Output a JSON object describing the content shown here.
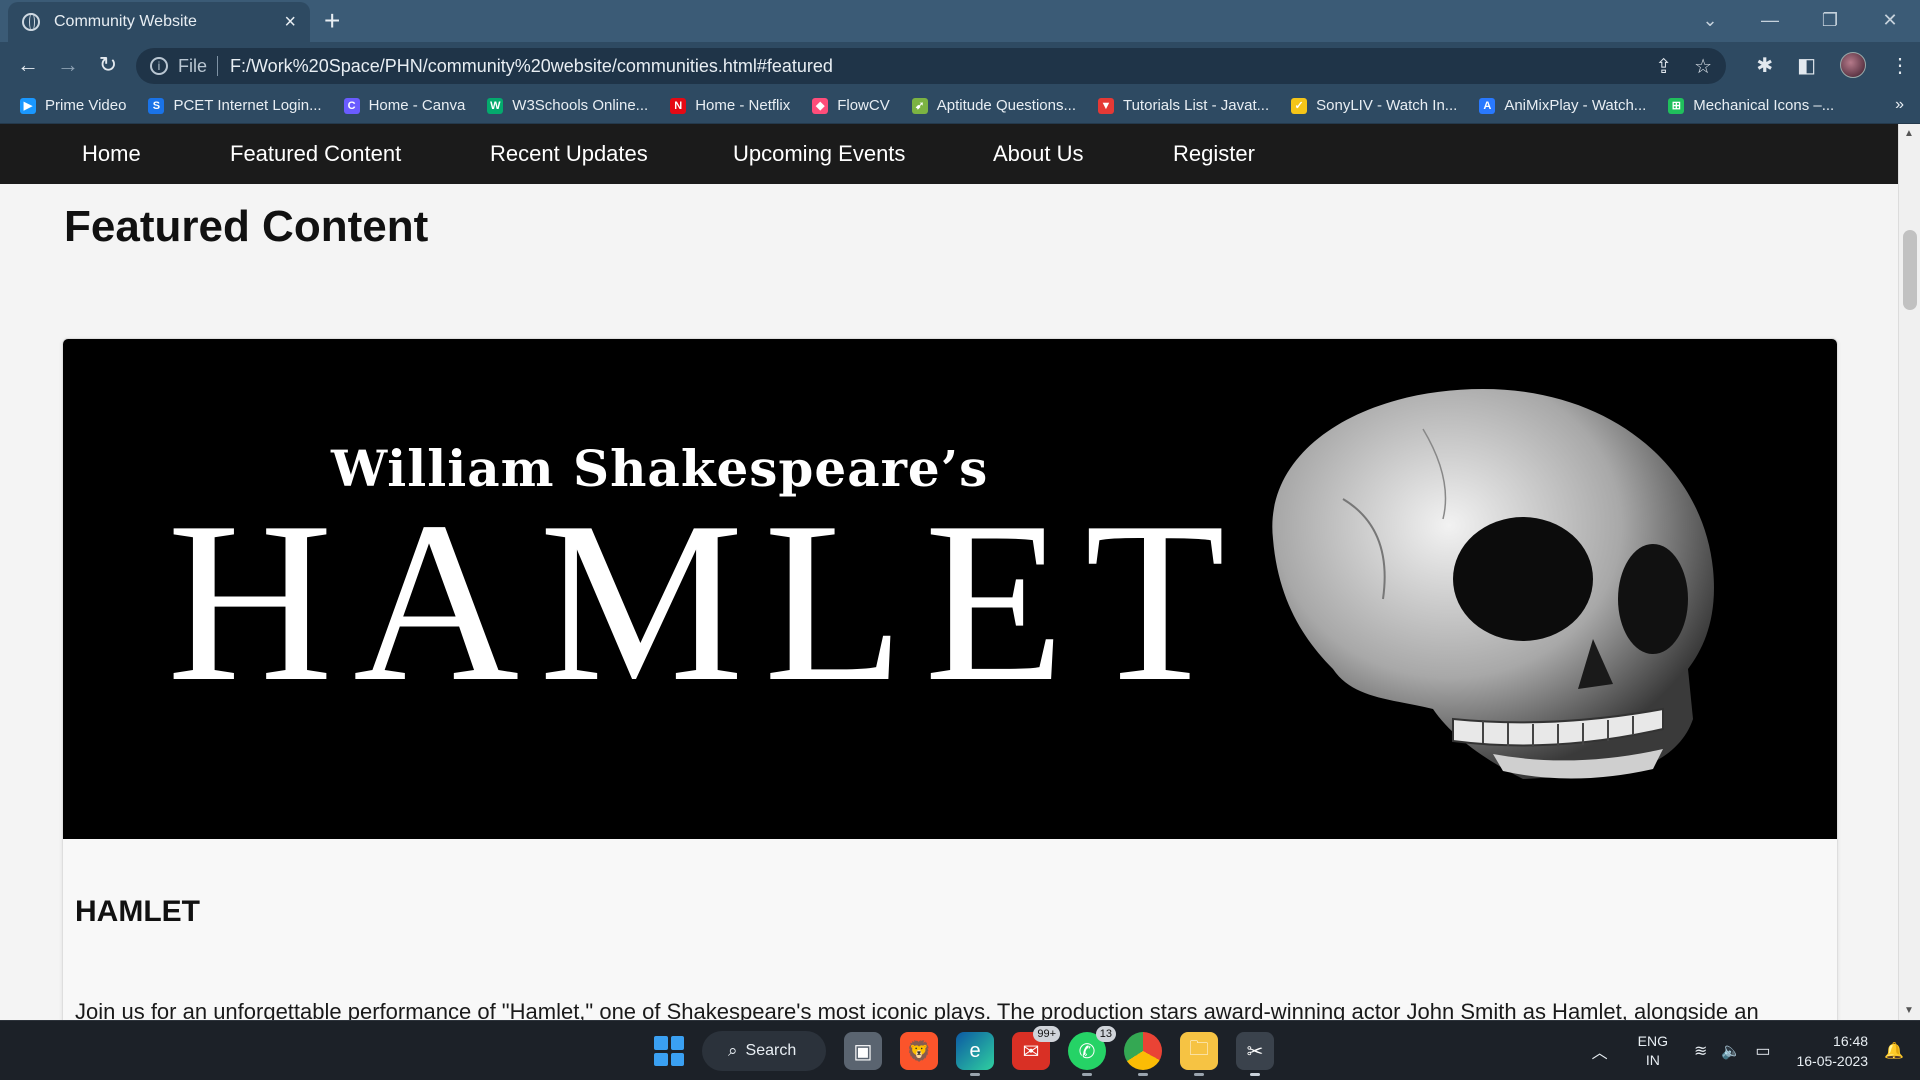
{
  "browser": {
    "tab_title": "Community Website",
    "url_scheme": "File",
    "url": "F:/Work%20Space/PHN/community%20website/communities.html#featured",
    "bookmarks": [
      {
        "label": "Prime Video",
        "color": "#1a98ff",
        "glyph": "▶"
      },
      {
        "label": "PCET Internet Login...",
        "color": "#1a73e8",
        "glyph": "S"
      },
      {
        "label": "Home - Canva",
        "color": "#6a5cff",
        "glyph": "C"
      },
      {
        "label": "W3Schools Online...",
        "color": "#04aa6d",
        "glyph": "W"
      },
      {
        "label": "Home - Netflix",
        "color": "#e50914",
        "glyph": "N"
      },
      {
        "label": "FlowCV",
        "color": "#ff4d7a",
        "glyph": "◆"
      },
      {
        "label": "Aptitude Questions...",
        "color": "#7cb342",
        "glyph": "➹"
      },
      {
        "label": "Tutorials List - Javat...",
        "color": "#e53935",
        "glyph": "▼"
      },
      {
        "label": "SonyLIV - Watch In...",
        "color": "#f5c518",
        "glyph": "✓"
      },
      {
        "label": "AniMixPlay - Watch...",
        "color": "#2979ff",
        "glyph": "A"
      },
      {
        "label": "Mechanical Icons –...",
        "color": "#20c05c",
        "glyph": "⊞"
      }
    ]
  },
  "site": {
    "nav": [
      "Home",
      "Featured Content",
      "Recent Updates",
      "Upcoming Events",
      "About Us",
      "Register"
    ],
    "page_heading": "Featured Content",
    "card": {
      "banner_subtitle": "William Shakespeare’s",
      "banner_title": "HAMLET",
      "title": "HAMLET",
      "description": "Join us for an unforgettable performance of \"Hamlet,\" one of Shakespeare's most iconic plays. The production stars award-winning actor John Smith as Hamlet, alongside an"
    }
  },
  "taskbar": {
    "search_label": "Search",
    "mail_badge": "99+",
    "whatsapp_badge": "13",
    "lang_top": "ENG",
    "lang_bottom": "IN",
    "time": "16:48",
    "date": "16-05-2023"
  }
}
